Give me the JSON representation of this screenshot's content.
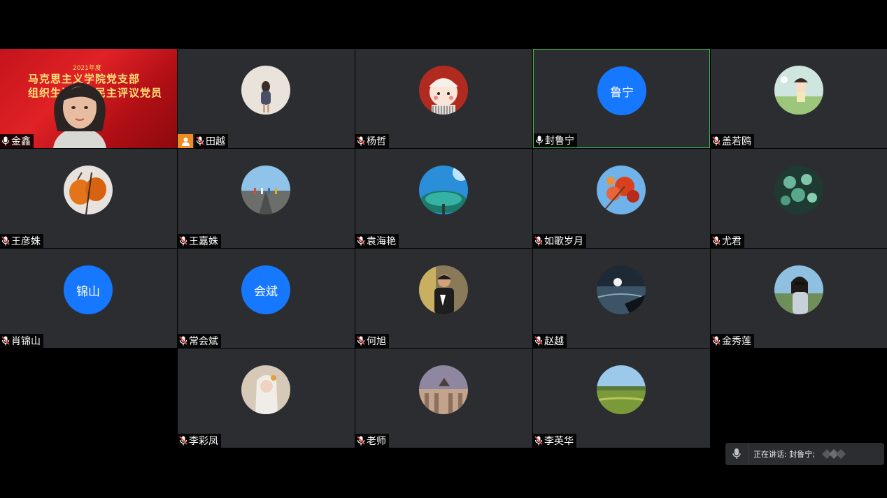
{
  "participants": [
    {
      "name": "金鑫",
      "type": "video",
      "row": 0,
      "col": 0,
      "mic": "on"
    },
    {
      "name": "田越",
      "type": "photo",
      "photo": "girl-backpack",
      "row": 0,
      "col": 1,
      "mic": "muted",
      "host": true
    },
    {
      "name": "杨哲",
      "type": "photo",
      "photo": "cartoon-girl",
      "row": 0,
      "col": 2,
      "mic": "muted"
    },
    {
      "name": "封鲁宁",
      "type": "initials",
      "initials": "鲁宁",
      "row": 0,
      "col": 3,
      "mic": "on",
      "active": true
    },
    {
      "name": "盖若鸥",
      "type": "photo",
      "photo": "cartoon-field",
      "row": 0,
      "col": 4,
      "mic": "muted"
    },
    {
      "name": "王彦姝",
      "type": "photo",
      "photo": "persimmons",
      "row": 1,
      "col": 0,
      "mic": "muted"
    },
    {
      "name": "王嘉姝",
      "type": "photo",
      "photo": "road-runners",
      "row": 1,
      "col": 1,
      "mic": "muted"
    },
    {
      "name": "袁海艳",
      "type": "photo",
      "photo": "blue-tree",
      "row": 1,
      "col": 2,
      "mic": "muted"
    },
    {
      "name": "如歌岁月",
      "type": "photo",
      "photo": "autumn-leaves",
      "row": 1,
      "col": 3,
      "mic": "muted"
    },
    {
      "name": "尤君",
      "type": "photo",
      "photo": "succulents",
      "row": 1,
      "col": 4,
      "mic": "muted"
    },
    {
      "name": "肖锦山",
      "type": "initials",
      "initials": "锦山",
      "row": 2,
      "col": 0,
      "mic": "muted"
    },
    {
      "name": "常会斌",
      "type": "initials",
      "initials": "会斌",
      "row": 2,
      "col": 1,
      "mic": "muted"
    },
    {
      "name": "何旭",
      "type": "photo",
      "photo": "man-portrait",
      "row": 2,
      "col": 2,
      "mic": "muted"
    },
    {
      "name": "赵越",
      "type": "photo",
      "photo": "night-sea",
      "row": 2,
      "col": 3,
      "mic": "muted"
    },
    {
      "name": "金秀莲",
      "type": "photo",
      "photo": "woman-sunglasses",
      "row": 2,
      "col": 4,
      "mic": "muted"
    },
    {
      "name": "李彩凤",
      "type": "photo",
      "photo": "bride",
      "row": 3,
      "col": 1,
      "mic": "muted"
    },
    {
      "name": "老师",
      "type": "photo",
      "photo": "building",
      "row": 3,
      "col": 2,
      "mic": "muted"
    },
    {
      "name": "李英华",
      "type": "photo",
      "photo": "green-field",
      "row": 3,
      "col": 3,
      "mic": "muted"
    }
  ],
  "featured_banner": {
    "year": "2021年度",
    "line1": "马克思主义学院党支部",
    "line2": "组织生活会和民主评议党员"
  },
  "status": {
    "speaking": "正在讲话: 封鲁宁;"
  },
  "colors": {
    "tile_bg": "#2b2d30",
    "initials_avatar": "#1677ff",
    "active_border": "#2fbf55",
    "host_badge": "#f08a24",
    "muted_mic": "#e8483f"
  },
  "icons": {
    "mic_on": "microphone-icon",
    "mic_muted": "microphone-muted-icon",
    "host": "host-user-icon"
  }
}
